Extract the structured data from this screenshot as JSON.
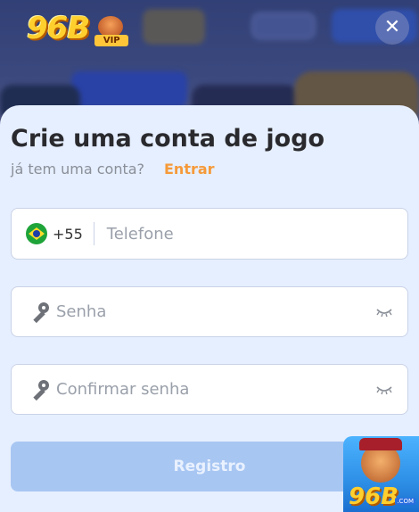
{
  "header": {
    "logo_text": "96B",
    "logo_badge": "VIP",
    "close_symbol": "✕"
  },
  "form": {
    "title": "Crie uma conta de jogo",
    "subtitle": "já tem uma conta?",
    "login_link": "Entrar",
    "phone": {
      "country_code": "+55",
      "country_flag": "brazil-flag-icon",
      "placeholder": "Telefone",
      "value": ""
    },
    "password": {
      "placeholder": "Senha",
      "value": ""
    },
    "confirm_password": {
      "placeholder": "Confirmar senha",
      "value": ""
    },
    "submit_label": "Registro"
  },
  "promo": {
    "logo_text": "96B",
    "domain_badge": ".COM"
  },
  "colors": {
    "sheet_bg": "#e6efff",
    "accent_link": "#f59a3a",
    "submit_disabled": "#a8c6f2",
    "title": "#2a2a2e"
  }
}
